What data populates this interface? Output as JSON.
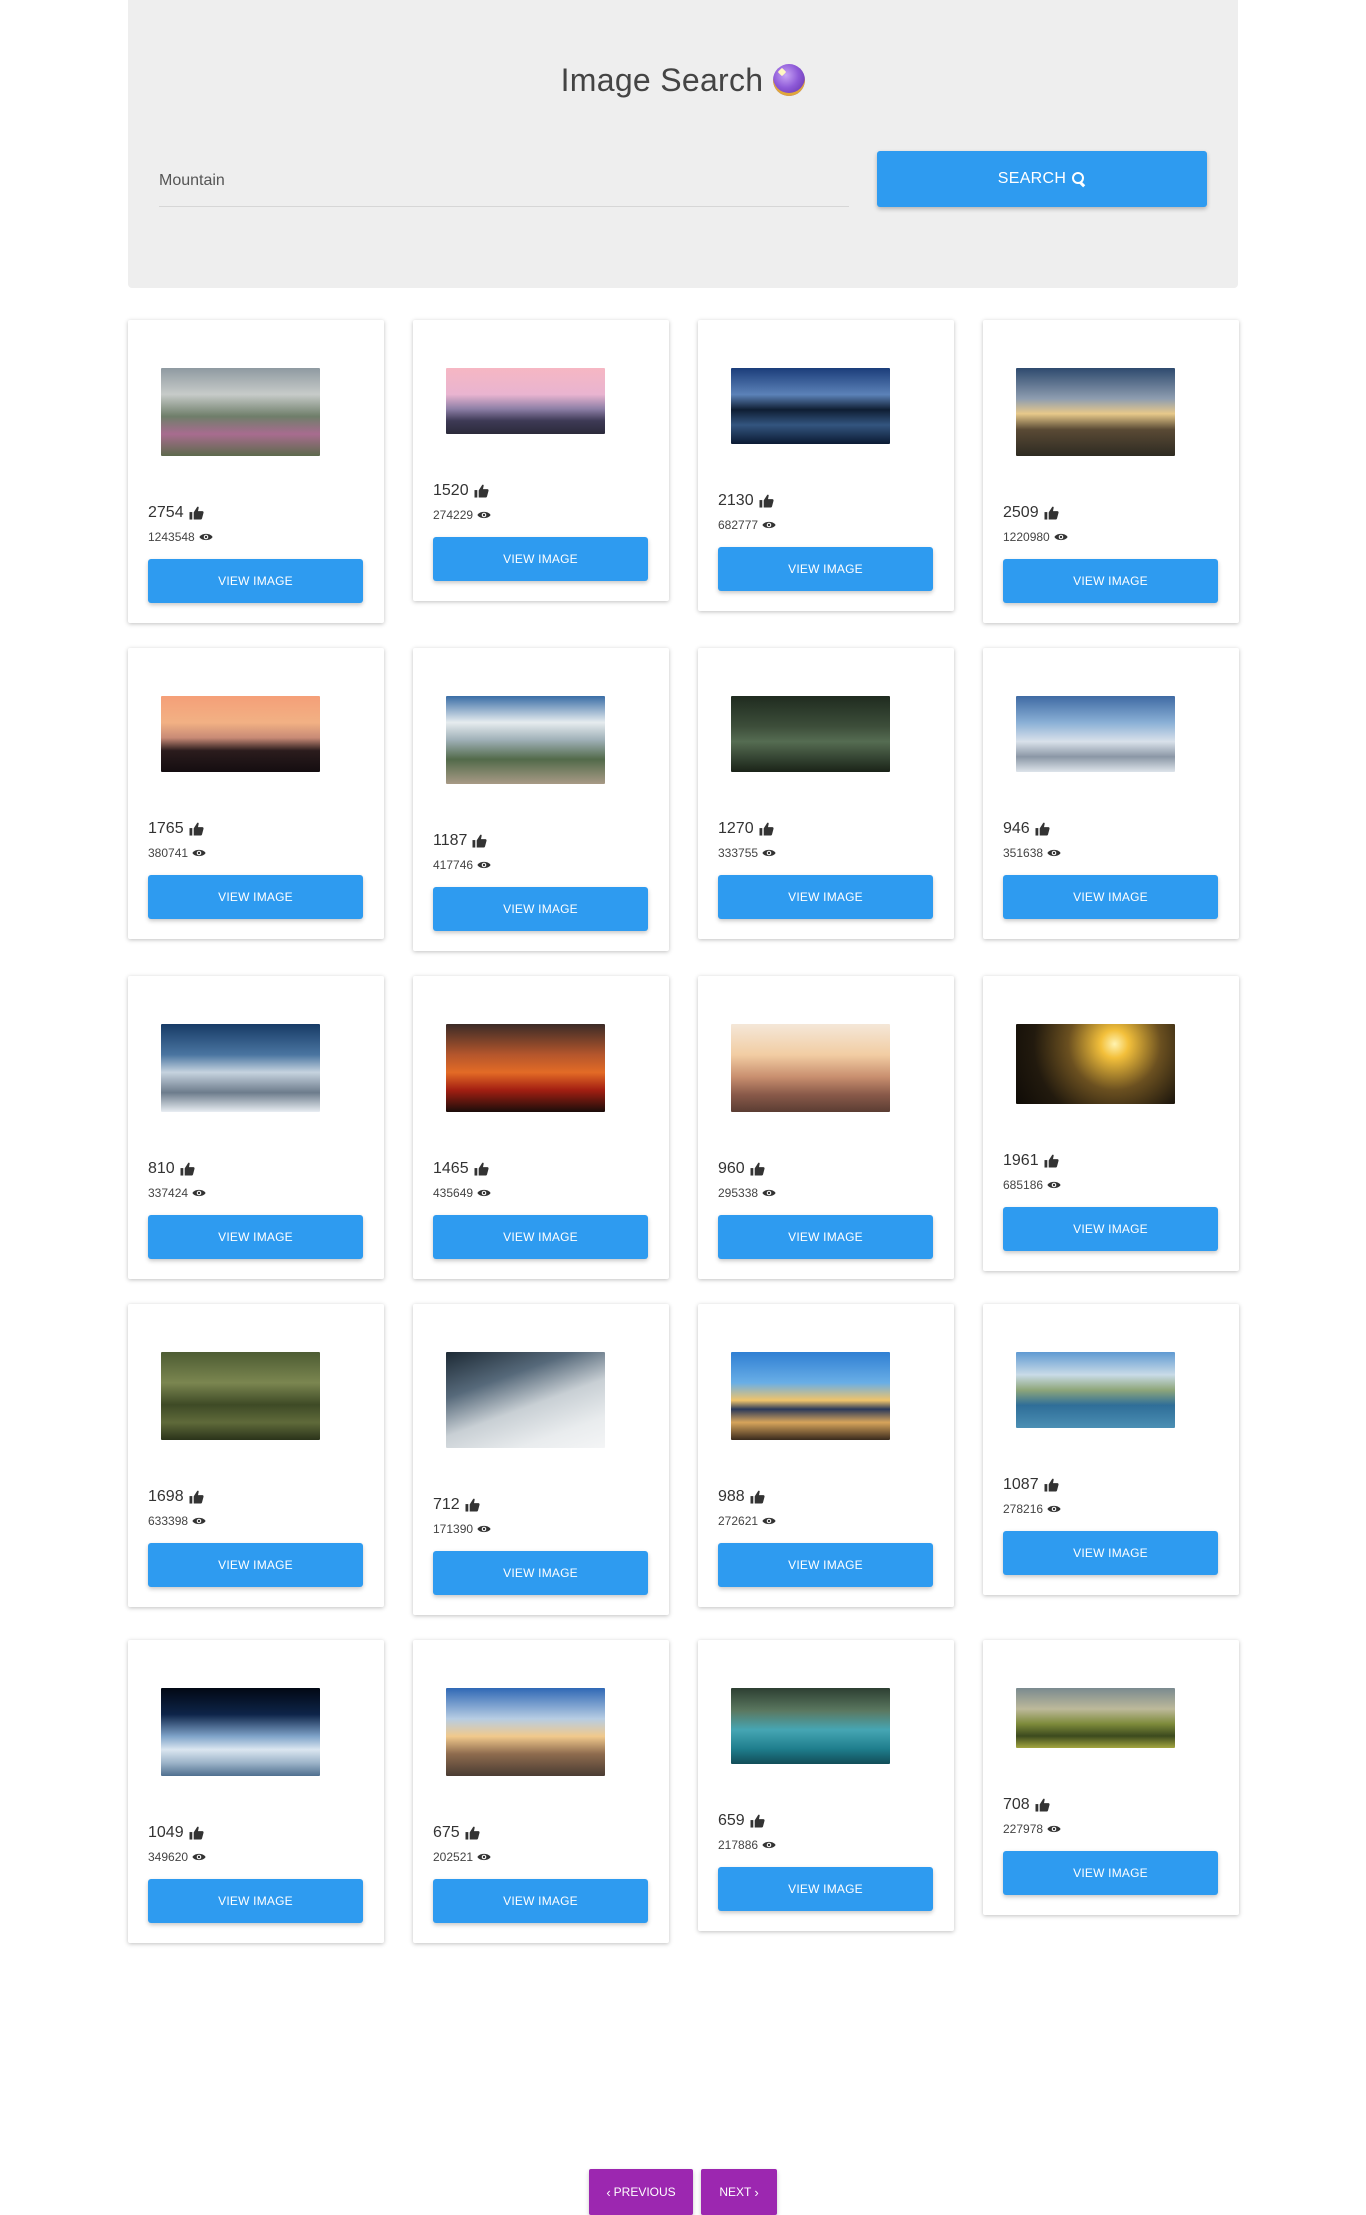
{
  "header": {
    "title": "Image Search",
    "icon": "crystal-ball-icon",
    "search_value": "Mountain",
    "search_button_label": "SEARCH"
  },
  "results": [
    {
      "likes": "2754",
      "views": "1243548",
      "button": "VIEW IMAGE",
      "thumb": "flowered-mountain-path"
    },
    {
      "likes": "1520",
      "views": "274229",
      "button": "VIEW IMAGE",
      "thumb": "pink-sky-mountains"
    },
    {
      "likes": "2130",
      "views": "682777",
      "button": "VIEW IMAGE",
      "thumb": "blue-lake-peaks"
    },
    {
      "likes": "2509",
      "views": "1220980",
      "button": "VIEW IMAGE",
      "thumb": "sunset-ridge"
    },
    {
      "likes": "1765",
      "views": "380741",
      "button": "VIEW IMAGE",
      "thumb": "orange-dusk-hills"
    },
    {
      "likes": "1187",
      "views": "417746",
      "button": "VIEW IMAGE",
      "thumb": "climber-cliff-clouds"
    },
    {
      "likes": "1270",
      "views": "333755",
      "button": "VIEW IMAGE",
      "thumb": "green-canyon"
    },
    {
      "likes": "946",
      "views": "351638",
      "button": "VIEW IMAGE",
      "thumb": "snowy-range-aerial"
    },
    {
      "likes": "810",
      "views": "337424",
      "button": "VIEW IMAGE",
      "thumb": "snow-peak-cloud"
    },
    {
      "likes": "1465",
      "views": "435649",
      "button": "VIEW IMAGE",
      "thumb": "red-sunset-birds"
    },
    {
      "likes": "960",
      "views": "295338",
      "button": "VIEW IMAGE",
      "thumb": "woman-on-rock"
    },
    {
      "likes": "1961",
      "views": "685186",
      "button": "VIEW IMAGE",
      "thumb": "silhouette-sunrise"
    },
    {
      "likes": "1698",
      "views": "633398",
      "button": "VIEW IMAGE",
      "thumb": "mossy-forest"
    },
    {
      "likes": "712",
      "views": "171390",
      "button": "VIEW IMAGE",
      "thumb": "misty-forest"
    },
    {
      "likes": "988",
      "views": "272621",
      "button": "VIEW IMAGE",
      "thumb": "mount-fuji"
    },
    {
      "likes": "1087",
      "views": "278216",
      "button": "VIEW IMAGE",
      "thumb": "alpine-lake"
    },
    {
      "likes": "1049",
      "views": "349620",
      "button": "VIEW IMAGE",
      "thumb": "earth-from-space"
    },
    {
      "likes": "675",
      "views": "202521",
      "button": "VIEW IMAGE",
      "thumb": "stacked-stones"
    },
    {
      "likes": "659",
      "views": "217886",
      "button": "VIEW IMAGE",
      "thumb": "turquoise-lake-boats"
    },
    {
      "likes": "708",
      "views": "227978",
      "button": "VIEW IMAGE",
      "thumb": "green-hills"
    }
  ],
  "pagination": {
    "previous_label": "PREVIOUS",
    "next_label": "NEXT"
  },
  "colors": {
    "primary_button": "#2e9bf0",
    "pagination_button": "#9c27b0",
    "header_background": "#eeeeee"
  }
}
